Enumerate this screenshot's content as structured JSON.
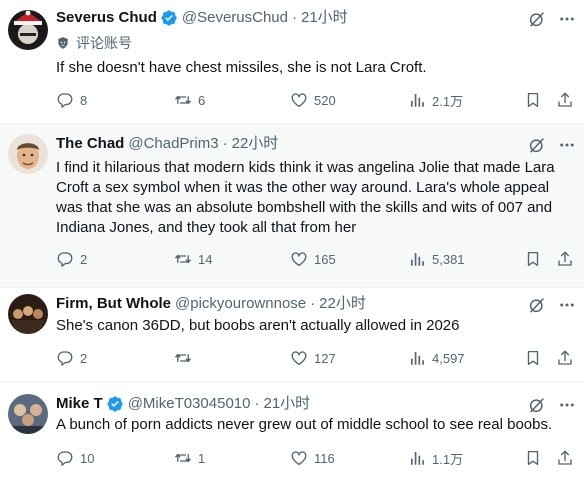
{
  "tweets": [
    {
      "name": "Severus Chud",
      "verified": true,
      "handle": "@SeverusChud",
      "time": "21小时",
      "sublabel": "评论账号",
      "text": "If she doesn't have chest missiles, she is not Lara Croft.",
      "replies": "8",
      "retweets": "6",
      "likes": "520",
      "views": "2.1万"
    },
    {
      "name": "The Chad",
      "verified": false,
      "handle": "@ChadPrim3",
      "time": "22小时",
      "text": "I find it hilarious that modern kids think it was angelina Jolie that made Lara Croft a sex symbol when it was the other way around.  Lara's whole appeal was that she was an absolute bombshell with the skills and wits of 007 and Indiana Jones, and they took all that from her",
      "replies": "2",
      "retweets": "14",
      "likes": "165",
      "views": "5,381"
    },
    {
      "name": "Firm, But Whole",
      "verified": false,
      "handle": "@pickyourownnose",
      "time": "22小时",
      "text": "She's canon 36DD, but boobs aren't actually allowed in 2026",
      "replies": "2",
      "retweets": "",
      "likes": "127",
      "views": "4,597"
    },
    {
      "name": "Mike T",
      "verified": true,
      "handle": "@MikeT03045010",
      "time": "21小时",
      "text": "A bunch of porn addicts never grew out of middle school to see real boobs.",
      "replies": "10",
      "retweets": "1",
      "likes": "116",
      "views": "1.1万"
    }
  ],
  "separator": "·",
  "colors": {
    "verified": "#1d9bf0",
    "muted": "#536471",
    "text": "#0f1419"
  }
}
